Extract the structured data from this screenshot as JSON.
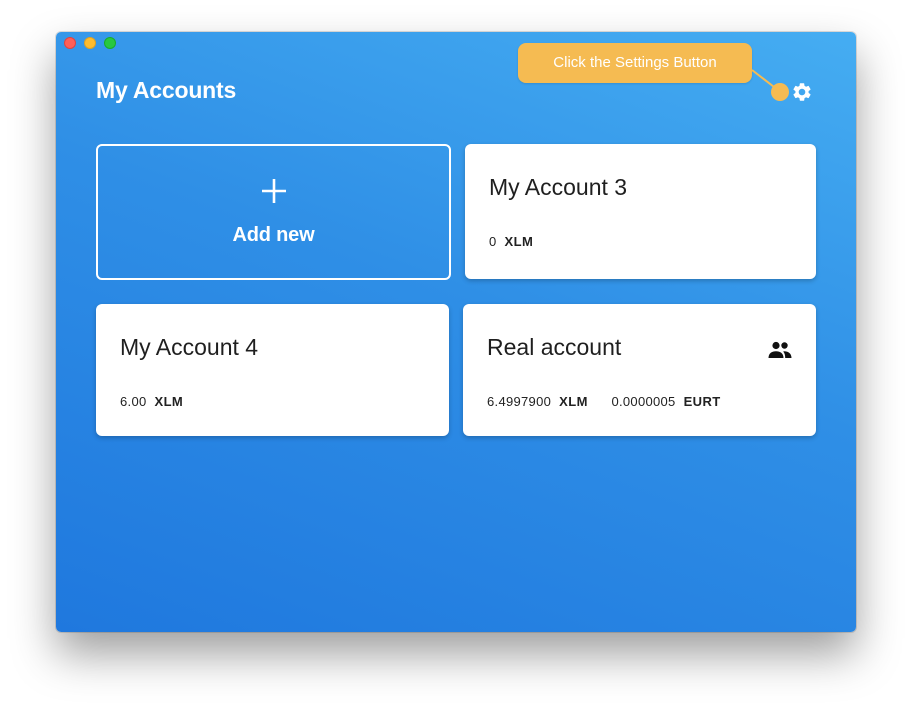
{
  "window": {
    "controls": [
      "close",
      "minimize",
      "maximize"
    ]
  },
  "header": {
    "title": "My Accounts",
    "settings_icon": "gear-icon"
  },
  "tooltip": {
    "text": "Click the Settings Button",
    "color": "#f5bb52"
  },
  "add_card": {
    "icon": "plus-icon",
    "label": "Add new"
  },
  "accounts": [
    {
      "name": "My Account 3",
      "balances": [
        {
          "amount": "0",
          "code": "XLM"
        }
      ]
    },
    {
      "name": "My Account 4",
      "balances": [
        {
          "amount": "6.00",
          "code": "XLM"
        }
      ]
    },
    {
      "name": "Real account",
      "icon": "shared-users-icon",
      "balances": [
        {
          "amount": "6.4997900",
          "code": "XLM"
        },
        {
          "amount": "0.0000005",
          "code": "EURT"
        }
      ]
    }
  ],
  "colors": {
    "background_top": "#45adf2",
    "background_bottom": "#1f78de",
    "card": "#ffffff",
    "accent": "#f5bb52"
  }
}
